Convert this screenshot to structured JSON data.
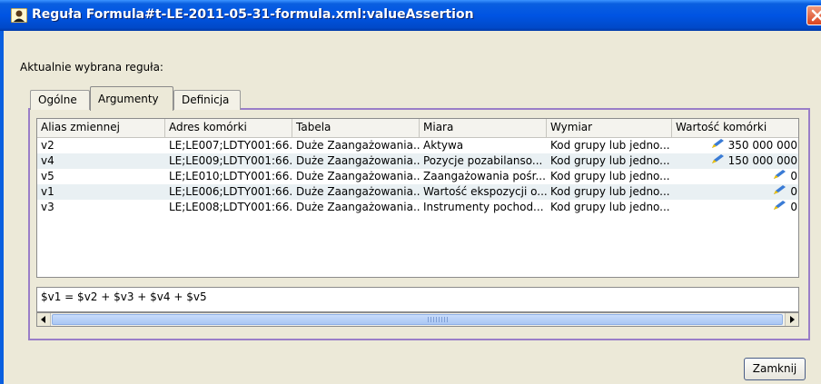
{
  "window": {
    "title": "Reguła Formula#t-LE-2011-05-31-formula.xml:valueAssertion",
    "accent": "#0054e3"
  },
  "current_rule_label": "Aktualnie wybrana reguła:",
  "tabs": [
    {
      "label": "Ogólne",
      "active": false
    },
    {
      "label": "Argumenty",
      "active": true
    },
    {
      "label": "Definicja",
      "active": false
    }
  ],
  "table": {
    "columns": [
      "Alias zmiennej",
      "Adres komórki",
      "Tabela",
      "Miara",
      "Wymiar",
      "Wartość komórki"
    ],
    "rows": [
      [
        "v2",
        "LE;LE007;LDTY001:66...",
        "Duże Zaangażowania...",
        "Aktywa",
        "Kod grupy lub jedno...",
        "350 000 000"
      ],
      [
        "v4",
        "LE;LE009;LDTY001:66...",
        "Duże Zaangażowania...",
        "Pozycje pozabilanso...",
        "Kod grupy lub jedno...",
        "150 000 000"
      ],
      [
        "v5",
        "LE;LE010;LDTY001:66...",
        "Duże Zaangażowania...",
        "Zaangażowania pośr...",
        "Kod grupy lub jedno...",
        "0"
      ],
      [
        "v1",
        "LE;LE006;LDTY001:66...",
        "Duże Zaangażowania...",
        "Wartość ekspozycji o...",
        "Kod grupy lub jedno...",
        "0"
      ],
      [
        "v3",
        "LE;LE008;LDTY001:66...",
        "Duże Zaangażowania...",
        "Instrumenty pochod...",
        "Kod grupy lub jedno...",
        "0"
      ]
    ]
  },
  "formula": "$v1 = $v2 + $v3 + $v4 + $v5",
  "buttons": {
    "close_label": "Zamknij"
  },
  "icons": {
    "title": "user-app-icon",
    "value": "pencil-icon",
    "close": "close-icon"
  }
}
